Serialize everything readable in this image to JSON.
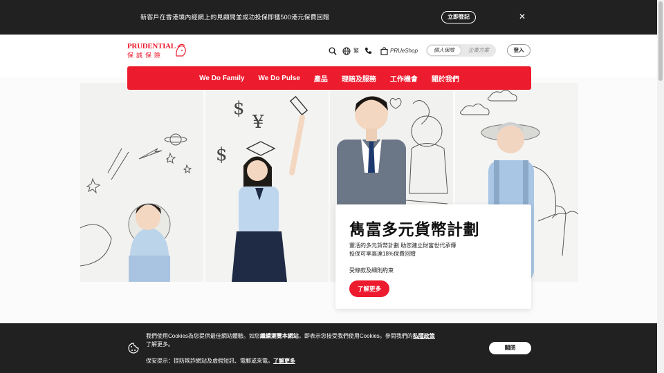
{
  "promo_bar": {
    "text": "新客戶在香港境內經網上約見顧問並成功投保即獲500港元保費回贈",
    "register_label": "立即登記",
    "close_icon": "close-icon"
  },
  "header": {
    "logo_en": "PRUDENTIAL",
    "logo_zh": "保誠保險",
    "lang_label": "繁",
    "shop_label": "PRUeShop",
    "toggle_personal": "個人保險",
    "toggle_business": "企業方案",
    "login_label": "登入"
  },
  "nav": {
    "items": [
      "We Do Family",
      "We Do Pulse",
      "產品",
      "理賠及服務",
      "工作機會",
      "關於我們"
    ]
  },
  "hero": {
    "title": "雋富多元貨幣計劃",
    "line1": "靈活的多元貨幣計劃 助您建立財富世代承傳",
    "line2": "投保可享高達18%保費回贈",
    "terms": "受條款及細則約束",
    "cta_label": "了解更多"
  },
  "cookie": {
    "text_before": "我們使用Cookies為您提供最佳網站體驗。如您",
    "text_bold1": "繼續瀏覽本網站",
    "text_middle": "，即表示您接受我們使用Cookies。參閱我們的",
    "text_bold2": "私隱政策",
    "text_after": "了解更多。",
    "warning_before": "保安提示：提防欺詐網站及虛假短訊、電郵或來電。",
    "warning_link": "了解更多",
    "close_label": "關閉"
  },
  "colors": {
    "brand_red": "#ed1b2e",
    "dark_bar": "#212121"
  }
}
